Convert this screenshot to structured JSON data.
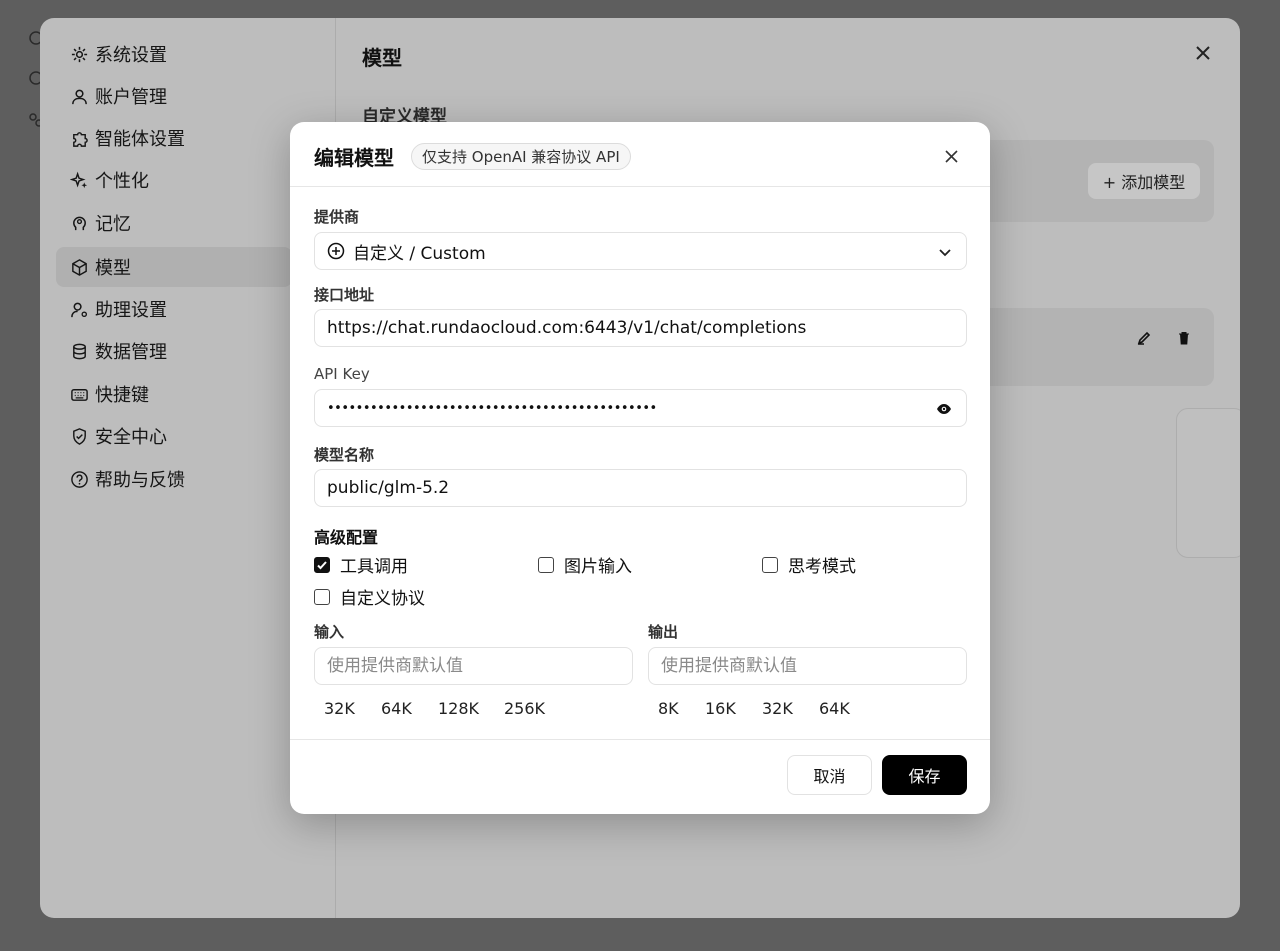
{
  "sidebar": {
    "items": [
      {
        "label": "系统设置",
        "icon": "gear-icon"
      },
      {
        "label": "账户管理",
        "icon": "user-icon"
      },
      {
        "label": "智能体设置",
        "icon": "puzzle-icon"
      },
      {
        "label": "个性化",
        "icon": "sparkles-icon"
      },
      {
        "label": "记忆",
        "icon": "brain-icon"
      },
      {
        "label": "模型",
        "icon": "cube-icon"
      },
      {
        "label": "助理设置",
        "icon": "user-gear-icon"
      },
      {
        "label": "数据管理",
        "icon": "database-icon"
      },
      {
        "label": "快捷键",
        "icon": "keyboard-icon"
      },
      {
        "label": "安全中心",
        "icon": "shield-check-icon"
      },
      {
        "label": "帮助与反馈",
        "icon": "help-circle-icon"
      }
    ],
    "active_index": 5
  },
  "content": {
    "title": "模型",
    "section_title": "自定义模型",
    "add_model_label": "+ 添加模型"
  },
  "modal": {
    "title": "编辑模型",
    "badge": "仅支持 OpenAI 兼容协议 API",
    "provider_label": "提供商",
    "provider_value": "自定义 / Custom",
    "endpoint_label": "接口地址",
    "endpoint_value": "https://chat.rundaocloud.com:6443/v1/chat/completions",
    "api_key_label": "API Key",
    "api_key_value": "••••••••••••••••••••••••••••••••••••••••••••••",
    "model_name_label": "模型名称",
    "model_name_value": "public/glm-5.2",
    "advanced_label": "高级配置",
    "options": [
      {
        "label": "工具调用",
        "checked": true
      },
      {
        "label": "图片输入",
        "checked": false
      },
      {
        "label": "思考模式",
        "checked": false
      },
      {
        "label": "自定义协议",
        "checked": false
      }
    ],
    "input_label": "输入",
    "input_placeholder": "使用提供商默认值",
    "input_presets": [
      "32K",
      "64K",
      "128K",
      "256K"
    ],
    "output_label": "输出",
    "output_placeholder": "使用提供商默认值",
    "output_presets": [
      "8K",
      "16K",
      "32K",
      "64K"
    ],
    "cancel_label": "取消",
    "save_label": "保存"
  },
  "colors": {
    "overlay": "#5e5e5e",
    "primary_button": "#000000",
    "modal_bg": "#ffffff"
  }
}
